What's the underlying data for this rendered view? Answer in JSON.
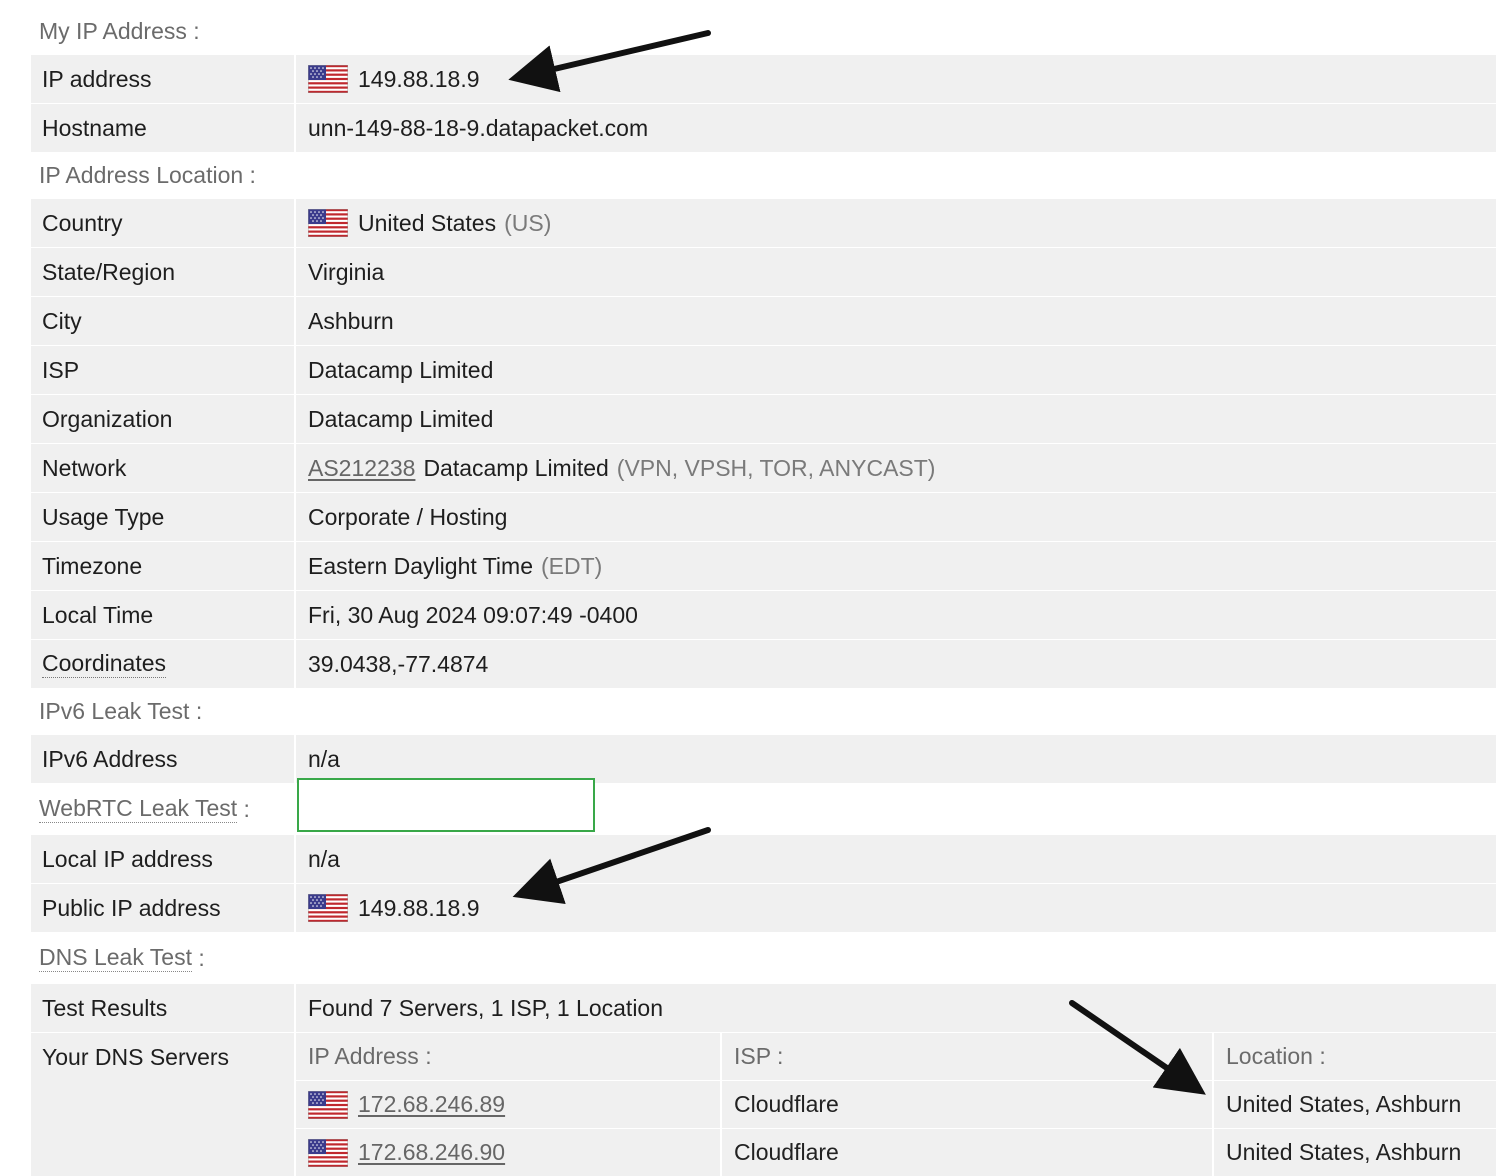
{
  "my_ip": {
    "heading": "My IP Address :",
    "ip_label": "IP address",
    "ip_value": "149.88.18.9",
    "host_label": "Hostname",
    "host_value": "unn-149-88-18-9.datapacket.com"
  },
  "location": {
    "heading": "IP Address Location :",
    "rows": {
      "country": {
        "label": "Country",
        "value": "United States",
        "extra": "(US)"
      },
      "state": {
        "label": "State/Region",
        "value": "Virginia"
      },
      "city": {
        "label": "City",
        "value": "Ashburn"
      },
      "isp": {
        "label": "ISP",
        "value": "Datacamp Limited"
      },
      "org": {
        "label": "Organization",
        "value": "Datacamp Limited"
      },
      "network": {
        "label": "Network",
        "link": "AS212238",
        "value": "Datacamp Limited",
        "extra": "(VPN, VPSH, TOR, ANYCAST)"
      },
      "usage": {
        "label": "Usage Type",
        "value": "Corporate / Hosting"
      },
      "timezone": {
        "label": "Timezone",
        "value": "Eastern Daylight Time",
        "extra": "(EDT)"
      },
      "local_time": {
        "label": "Local Time",
        "value": "Fri, 30 Aug 2024 09:07:49 -0400"
      },
      "coords": {
        "label": "Coordinates",
        "value": "39.0438,-77.4874"
      }
    }
  },
  "ipv6": {
    "heading": "IPv6 Leak Test :",
    "label": "IPv6 Address",
    "value": "n/a"
  },
  "webrtc": {
    "heading": "WebRTC Leak Test",
    "heading_suffix": " :",
    "local_label": "Local IP address",
    "local_value": "n/a",
    "public_label": "Public IP address",
    "public_value": "149.88.18.9"
  },
  "dns": {
    "heading": "DNS Leak Test",
    "heading_suffix": " :",
    "results_label": "Test Results",
    "results_value": "Found 7 Servers, 1 ISP, 1 Location",
    "servers_label": "Your DNS Servers",
    "col_ip": "IP Address :",
    "col_isp": "ISP :",
    "col_location": "Location :",
    "servers": [
      {
        "ip": "172.68.246.89",
        "isp": "Cloudflare",
        "location": "United States, Ashburn"
      },
      {
        "ip": "172.68.246.90",
        "isp": "Cloudflare",
        "location": "United States, Ashburn"
      }
    ]
  },
  "colors": {
    "panel": "#f0f0f0",
    "muted": "#6b6b6b",
    "highlight_border": "#39a849",
    "arrow": "#111111"
  },
  "icons": [
    "us-flag-icon",
    "arrow-annotation"
  ]
}
